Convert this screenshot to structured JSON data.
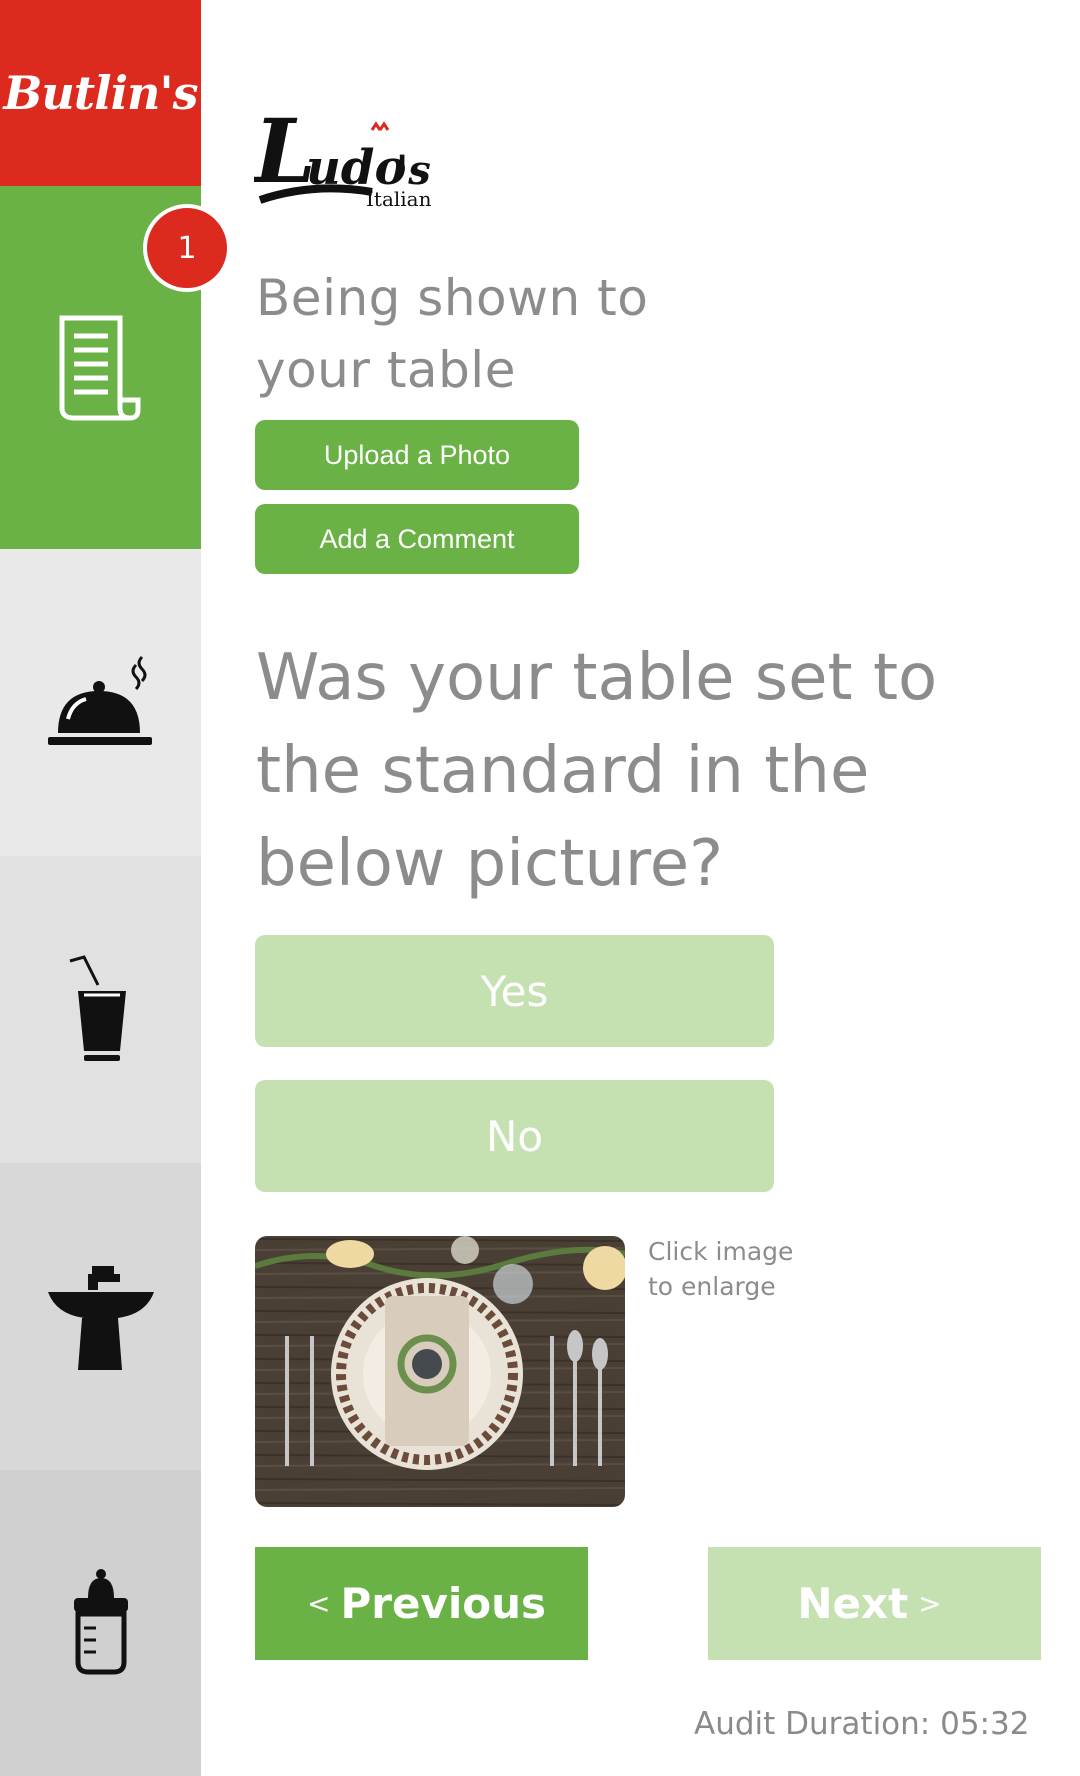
{
  "sidebar": {
    "brand": "Butlin's",
    "badge_count": "1",
    "items": [
      {
        "icon": "checklist-icon",
        "active": true
      },
      {
        "icon": "service-cloche-icon",
        "active": false
      },
      {
        "icon": "drink-cup-icon",
        "active": false
      },
      {
        "icon": "sink-icon",
        "active": false
      },
      {
        "icon": "baby-bottle-icon",
        "active": false
      }
    ]
  },
  "header": {
    "logo_text": "Ludo's",
    "logo_subtext": "Italian"
  },
  "section": {
    "title": "Being shown to your table",
    "upload_label": "Upload a Photo",
    "comment_label": "Add a Comment"
  },
  "question": {
    "text": "Was your table set to the standard in the below picture?",
    "yes_label": "Yes",
    "no_label": "No"
  },
  "reference_image": {
    "hint_line1": "Click image",
    "hint_line2": "to enlarge"
  },
  "navigation": {
    "prev_arrow": "<",
    "prev_label": "Previous",
    "next_label": "Next",
    "next_arrow": ">"
  },
  "footer": {
    "duration": "Audit Duration: 05:32"
  },
  "colors": {
    "brand_red": "#dc2a1f",
    "green": "#6ab245",
    "light_green": "#c5e1b2"
  }
}
